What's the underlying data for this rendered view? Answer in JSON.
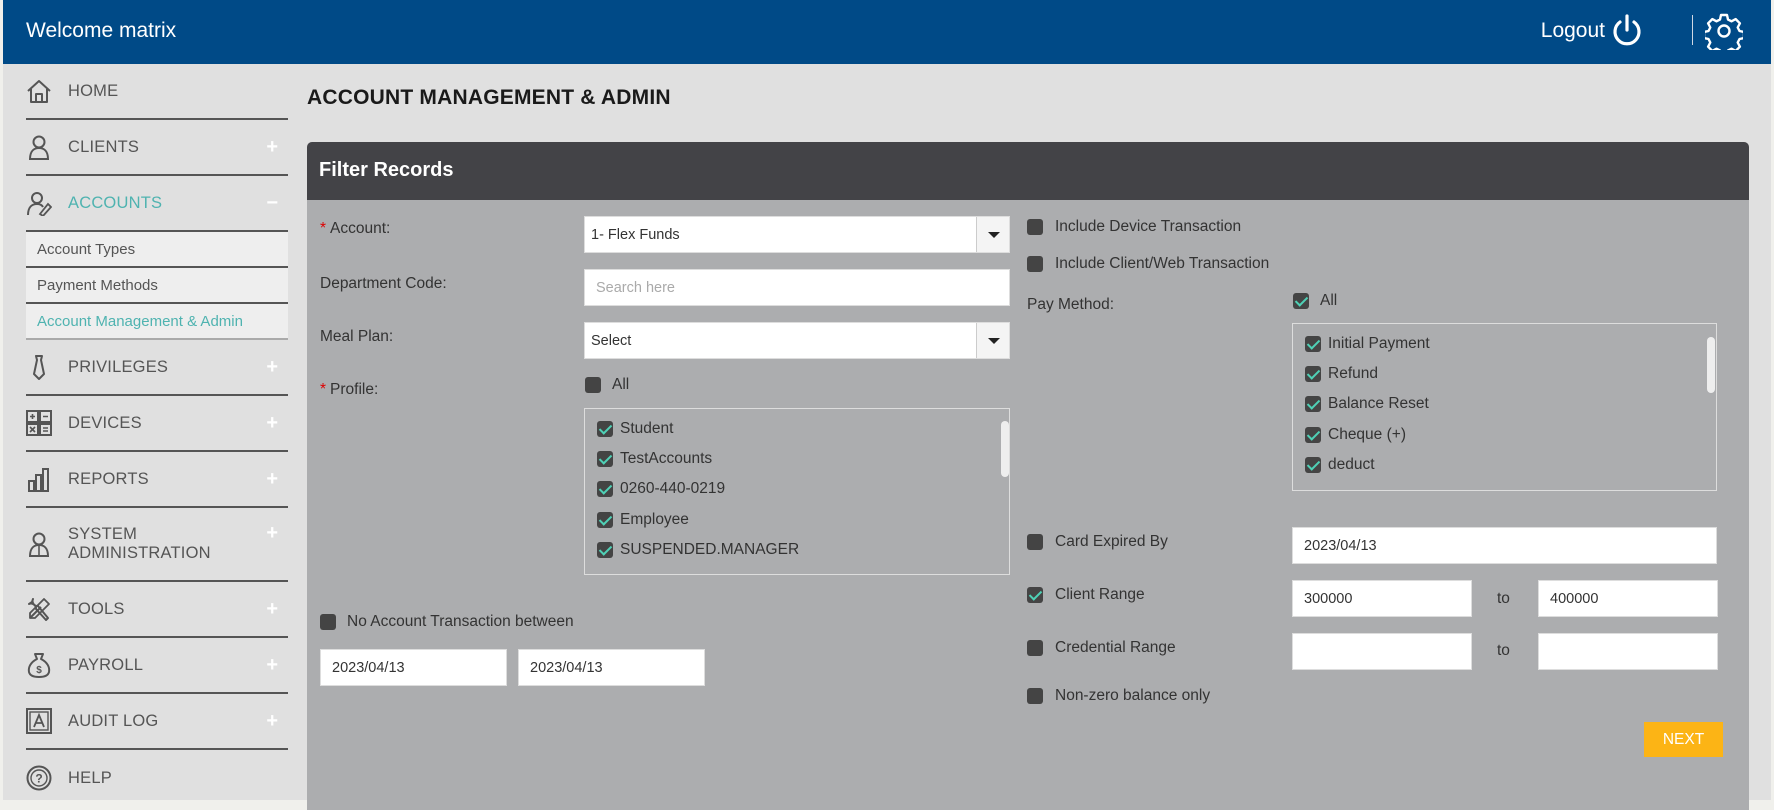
{
  "header": {
    "welcome": "Welcome matrix",
    "logout_label": "Logout"
  },
  "sidebar": {
    "items": [
      {
        "label": "HOME",
        "icon": "home-icon"
      },
      {
        "label": "CLIENTS",
        "toggle": "+",
        "icon": "client-icon"
      },
      {
        "label": "ACCOUNTS",
        "toggle": "−",
        "icon": "accounts-icon"
      },
      {
        "label": "PRIVILEGES",
        "toggle": "+",
        "icon": "tie-icon"
      },
      {
        "label": "DEVICES",
        "toggle": "+",
        "icon": "calculator-icon"
      },
      {
        "label": "REPORTS",
        "toggle": "+",
        "icon": "bar-chart-icon"
      },
      {
        "label": "SYSTEM",
        "label2": "ADMINISTRATION",
        "toggle": "+",
        "icon": "admin-user-icon"
      },
      {
        "label": "TOOLS",
        "toggle": "+",
        "icon": "tools-icon"
      },
      {
        "label": "PAYROLL",
        "toggle": "+",
        "icon": "money-bag-icon"
      },
      {
        "label": "AUDIT LOG",
        "toggle": "+",
        "icon": "audit-icon"
      },
      {
        "label": "HELP",
        "icon": "help-icon"
      }
    ],
    "accounts_sub": [
      "Account Types",
      "Payment Methods",
      "Account Management & Admin"
    ]
  },
  "page": {
    "title": "ACCOUNT MANAGEMENT & ADMIN",
    "panel_title": "Filter Records"
  },
  "form": {
    "account_req": "*",
    "account_label": "Account:",
    "account_value": "1- Flex Funds",
    "department_label": "Department Code:",
    "department_placeholder": "Search here",
    "meal_plan_label": "Meal Plan:",
    "meal_plan_value": "Select",
    "profile_req": "*",
    "profile_label": "Profile:",
    "profile_all_label": "All",
    "profiles": [
      {
        "label": "Student",
        "checked": true
      },
      {
        "label": "TestAccounts",
        "checked": true
      },
      {
        "label": "0260-440-0219",
        "checked": true
      },
      {
        "label": "Employee",
        "checked": true
      },
      {
        "label": "SUSPENDED.MANAGER",
        "checked": true
      }
    ],
    "no_txn_label": "No Account Transaction between",
    "no_txn_from": "2023/04/13",
    "no_txn_to": "2023/04/13",
    "include_device_label": "Include Device Transaction",
    "include_client_label": "Include Client/Web Transaction",
    "pay_method_label": "Pay Method:",
    "pay_all_label": "All",
    "pay_methods": [
      {
        "label": "Initial Payment",
        "checked": true
      },
      {
        "label": "Refund",
        "checked": true
      },
      {
        "label": "Balance Reset",
        "checked": true
      },
      {
        "label": "Cheque (+)",
        "checked": true
      },
      {
        "label": "deduct",
        "checked": true
      }
    ],
    "card_expired_label": "Card Expired By",
    "card_expired_value": "2023/04/13",
    "client_range_label": "Client Range",
    "client_range_from": "300000",
    "client_range_to": "400000",
    "to_label": "to",
    "credential_range_label": "Credential Range",
    "credential_from": "",
    "credential_to": "",
    "non_zero_label": "Non-zero balance only",
    "next_label": "NEXT"
  }
}
